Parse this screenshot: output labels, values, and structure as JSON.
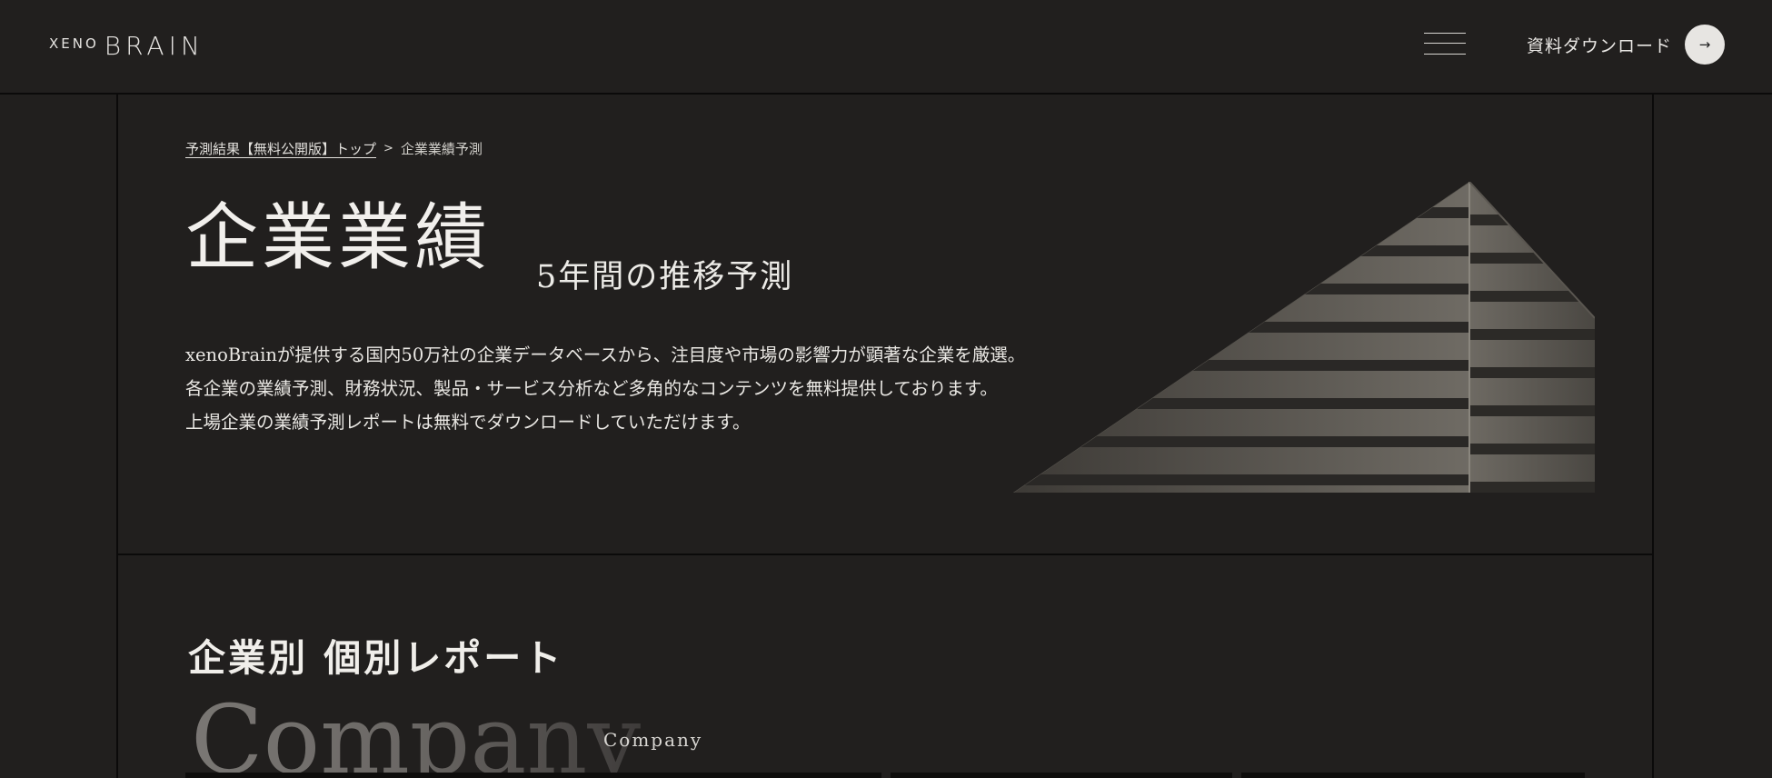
{
  "header": {
    "logo_prefix": "XENO",
    "logo_main": "BRAIN",
    "download_label": "資料ダウンロード",
    "download_arrow": "→"
  },
  "breadcrumb": {
    "link": "予測結果【無料公開版】トップ",
    "separator": ">",
    "current": "企業業績予測"
  },
  "hero": {
    "title": "企業業績",
    "subtitle": "5年間の推移予測",
    "description": [
      "xenoBrainが提供する国内50万社の企業データベースから、注目度や市場の影響力が顕著な企業を厳選。",
      "各企業の業績予測、財務状況、製品・サービス分析など多角的なコンテンツを無料提供しております。",
      "上場企業の業績予測レポートは無料でダウンロードしていただけます。"
    ]
  },
  "section": {
    "title": "企業別 個別レポート",
    "bg_word": "Company",
    "label": "Company"
  },
  "colors": {
    "background": "#211f1e",
    "text": "#e8e6e3",
    "lines": "#0b0a0a",
    "button": "#e7e5e2"
  },
  "icons": {
    "menu": "hamburger-icon",
    "download": "arrow-right-icon",
    "image": "building-image"
  }
}
